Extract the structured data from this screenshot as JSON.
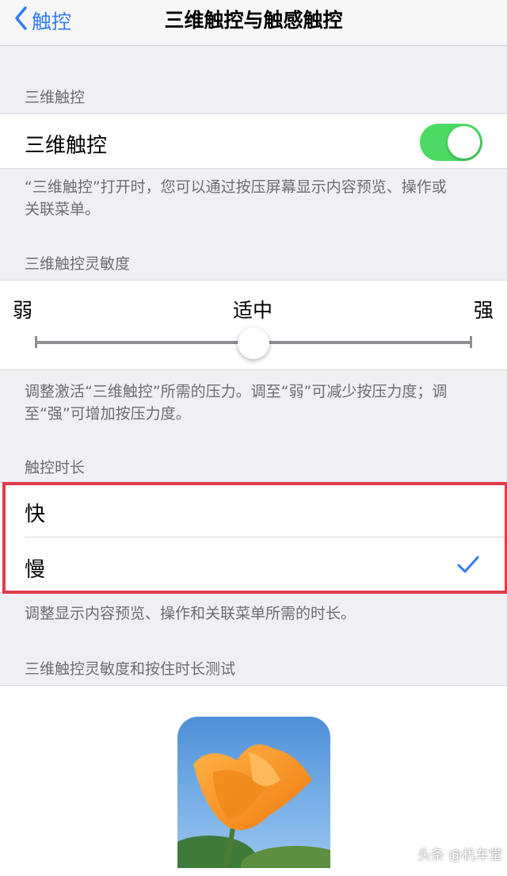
{
  "nav": {
    "back_label": "触控",
    "title": "三维触控与触感触控"
  },
  "section_3d": {
    "header": "三维触控",
    "row_label": "三维触控",
    "toggle_on": true,
    "footnote_line1": "“三维触控”打开时，您可以通过按压屏幕显示内容预览、操作或",
    "footnote_line2": "关联菜单。"
  },
  "sensitivity": {
    "header": "三维触控灵敏度",
    "low_label": "弱",
    "mid_label": "适中",
    "high_label": "强",
    "level": 0.5,
    "footnote_line1": "调整激活“三维触控”所需的压力。调至“弱”可减少按压力度；调",
    "footnote_line2": "至“强”可增加按压力度。"
  },
  "duration": {
    "header": "触控时长",
    "options": [
      {
        "label": "快",
        "selected": false
      },
      {
        "label": "慢",
        "selected": true
      }
    ],
    "footnote": "调整显示内容预览、操作和关联菜单所需的时长。"
  },
  "test": {
    "header": "三维触控灵敏度和按住时长测试"
  },
  "colors": {
    "accent": "#2f7cf6",
    "toggle_on": "#4cd964",
    "highlight": "#e23b4a",
    "background": "#efeff4"
  },
  "watermark": "头条 @机车堂"
}
